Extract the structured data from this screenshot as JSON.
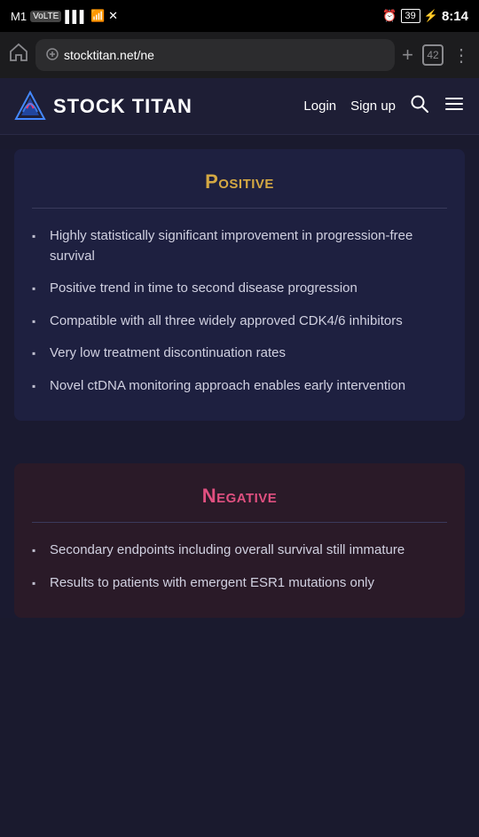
{
  "statusBar": {
    "carrier": "M1",
    "carrierType": "VoLTE",
    "time": "8:14",
    "battery": "39",
    "alarmIcon": "⏰"
  },
  "browser": {
    "url": "stocktitan.net/ne",
    "tabsCount": "42",
    "homeLabel": "⌂",
    "newTabLabel": "+",
    "menuLabel": "⋮"
  },
  "header": {
    "siteTitle": "STOCK TITAN",
    "loginLabel": "Login",
    "signupLabel": "Sign up"
  },
  "positive": {
    "title": "Positive",
    "divider": true,
    "bullets": [
      "Highly statistically significant improvement in progression-free survival",
      "Positive trend in time to second disease progression",
      "Compatible with all three widely approved CDK4/6 inhibitors",
      "Very low treatment discontinuation rates",
      "Novel ctDNA monitoring approach enables early intervention"
    ]
  },
  "negative": {
    "title": "Negative",
    "divider": true,
    "bullets": [
      "Secondary endpoints including overall survival still immature",
      "Results to patients with emergent ESR1 mutations only"
    ]
  }
}
